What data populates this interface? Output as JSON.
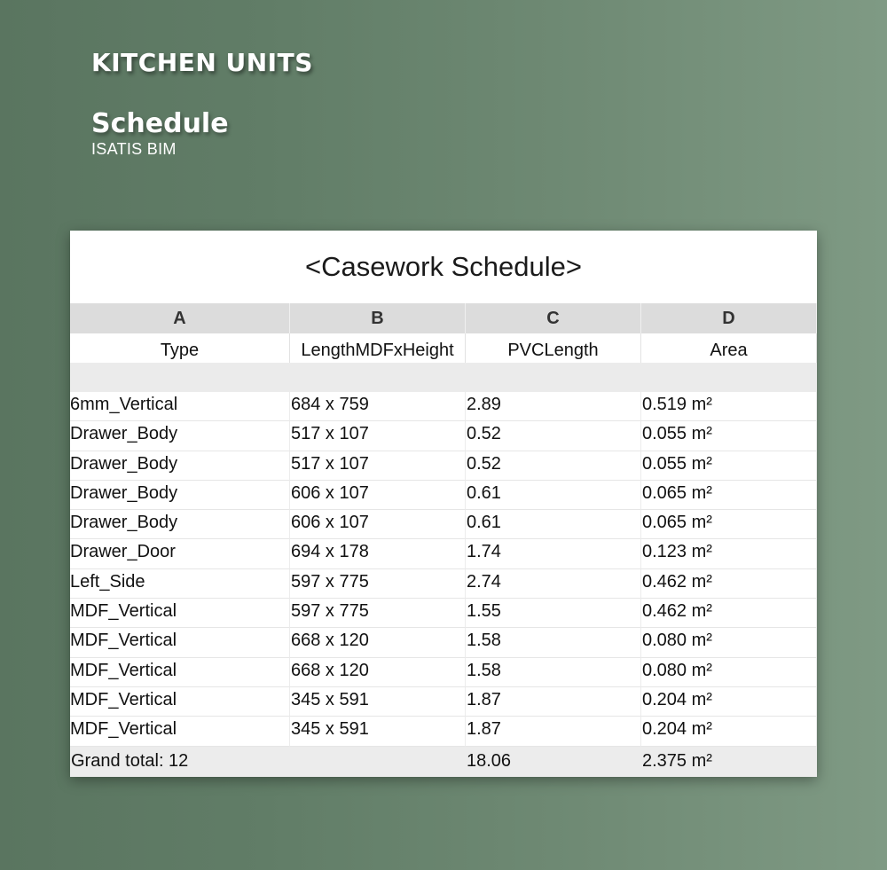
{
  "header": {
    "main_title": "KITCHEN UNITS",
    "sub_title": "Schedule",
    "brand": "ISATIS BIM"
  },
  "schedule": {
    "title": "<Casework Schedule>",
    "column_letters": [
      "A",
      "B",
      "C",
      "D"
    ],
    "column_headers": [
      "Type",
      "LengthMDFxHeight",
      "PVCLength",
      "Area"
    ],
    "rows": [
      [
        "6mm_Vertical",
        "684 x 759",
        "2.89",
        "0.519 m²"
      ],
      [
        "Drawer_Body",
        "517 x 107",
        "0.52",
        "0.055 m²"
      ],
      [
        "Drawer_Body",
        "517 x 107",
        "0.52",
        "0.055 m²"
      ],
      [
        "Drawer_Body",
        "606 x 107",
        "0.61",
        "0.065 m²"
      ],
      [
        "Drawer_Body",
        "606 x 107",
        "0.61",
        "0.065 m²"
      ],
      [
        "Drawer_Door",
        "694 x 178",
        "1.74",
        "0.123 m²"
      ],
      [
        "Left_Side",
        "597 x 775",
        "2.74",
        "0.462 m²"
      ],
      [
        "MDF_Vertical",
        "597 x 775",
        "1.55",
        "0.462 m²"
      ],
      [
        "MDF_Vertical",
        "668 x 120",
        "1.58",
        "0.080 m²"
      ],
      [
        "MDF_Vertical",
        "668 x 120",
        "1.58",
        "0.080 m²"
      ],
      [
        "MDF_Vertical",
        "345 x 591",
        "1.87",
        "0.204 m²"
      ],
      [
        "MDF_Vertical",
        "345 x 591",
        "1.87",
        "0.204 m²"
      ]
    ],
    "total": [
      "Grand total: 12",
      "",
      "18.06",
      "2.375 m²"
    ]
  }
}
